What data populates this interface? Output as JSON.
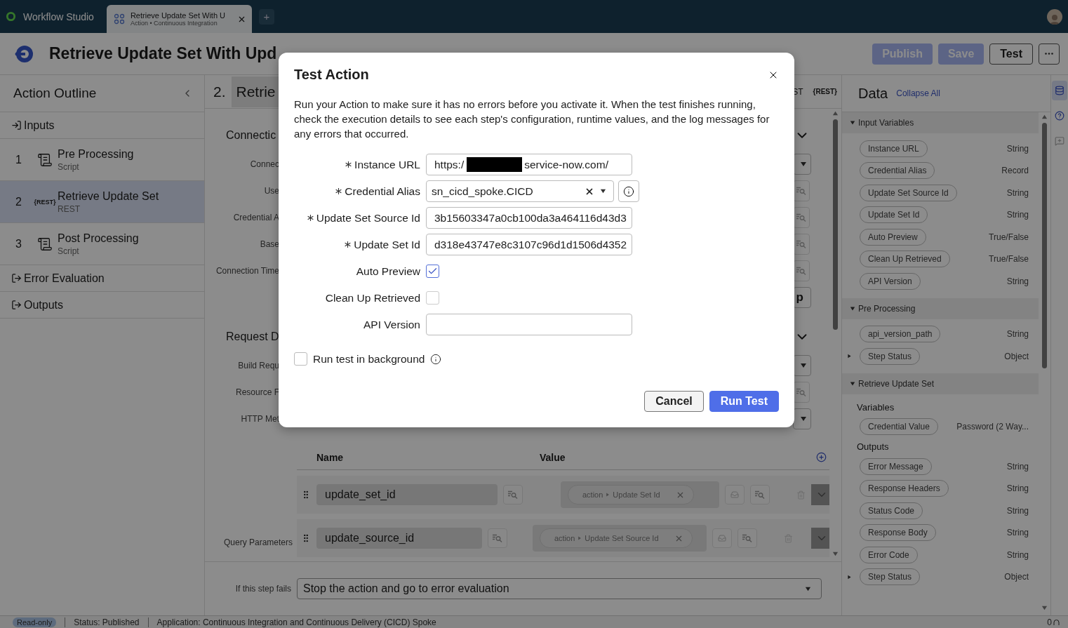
{
  "app": {
    "name": "Workflow Studio"
  },
  "tabs": [
    {
      "title": "Retrieve Update Set With U",
      "subtitle": "Action • Continuous Integration",
      "selected": true
    }
  ],
  "new_tab": "+",
  "header": {
    "title": "Retrieve Update Set With Upd",
    "buttons": [
      {
        "label": "Publish",
        "kind": "primary",
        "disabled": true
      },
      {
        "label": "Save",
        "kind": "primary",
        "disabled": true
      },
      {
        "label": "Test",
        "kind": "secondary",
        "disabled": false
      }
    ]
  },
  "outline": {
    "title": "Action Outline",
    "items": [
      {
        "kind": "entry",
        "label": "Inputs"
      },
      {
        "kind": "script_step",
        "number": "1",
        "name": "Pre Processing",
        "type": "Script",
        "selected": false
      },
      {
        "kind": "rest_step",
        "number": "2",
        "icon_text": "{REST}",
        "name": "Retrieve Update Set",
        "type": "REST",
        "selected": true
      },
      {
        "kind": "script_step",
        "number": "3",
        "name": "Post Processing",
        "type": "Script",
        "selected": false
      },
      {
        "kind": "exit",
        "label": "Error Evaluation"
      },
      {
        "kind": "exit",
        "label": "Outputs"
      }
    ]
  },
  "step": {
    "number": "2.",
    "title": "Retrie",
    "tag": "ST",
    "badge": "{REST}",
    "sections": [
      {
        "title": "Connectic",
        "fields": [
          {
            "kind": "dropdown",
            "label": "Connec"
          },
          {
            "kind": "picker",
            "label": "Use"
          },
          {
            "kind": "picker",
            "label": "Credential A"
          },
          {
            "kind": "picker",
            "label": "Base"
          },
          {
            "kind": "picker",
            "label": "Connection Time"
          },
          {
            "kind": "button",
            "text": "p"
          }
        ]
      },
      {
        "title": "Request D",
        "fields": [
          {
            "kind": "dropdown",
            "label": "Build Requ"
          },
          {
            "kind": "picker",
            "label": "Resource F"
          },
          {
            "kind": "dropdown",
            "label": "HTTP Met"
          }
        ]
      }
    ],
    "table": {
      "label": "Query Parameters",
      "columns": [
        "Name",
        "Value"
      ],
      "rows": [
        {
          "name": "update_set_id",
          "scope": "action",
          "value": "Update Set Id"
        },
        {
          "name": "update_source_id",
          "scope": "action",
          "value": "Update Set Source Id"
        }
      ]
    },
    "on_failure": {
      "label": "If this step fails",
      "value": "Stop the action and go to error evaluation"
    }
  },
  "data": {
    "title": "Data",
    "collapse_link": "Collapse All",
    "groups": [
      {
        "title": "Input Variables",
        "expanded": true,
        "subgroups": [
          {
            "items": [
              {
                "name": "Instance URL",
                "type": "String",
                "expandable": false
              },
              {
                "name": "Credential Alias",
                "type": "Record",
                "expandable": false
              },
              {
                "name": "Update Set Source Id",
                "type": "String",
                "expandable": false
              },
              {
                "name": "Update Set Id",
                "type": "String",
                "expandable": false
              },
              {
                "name": "Auto Preview",
                "type": "True/False",
                "expandable": false
              },
              {
                "name": "Clean Up Retrieved",
                "type": "True/False",
                "expandable": false
              },
              {
                "name": "API Version",
                "type": "String",
                "expandable": false
              }
            ]
          }
        ]
      },
      {
        "title": "Pre Processing",
        "expanded": true,
        "subgroups": [
          {
            "items": [
              {
                "name": "api_version_path",
                "type": "String",
                "expandable": false
              },
              {
                "name": "Step Status",
                "type": "Object",
                "expandable": true
              }
            ]
          }
        ]
      },
      {
        "title": "Retrieve Update Set",
        "expanded": true,
        "subgroups": [
          {
            "title": "Variables",
            "items": [
              {
                "name": "Credential Value",
                "type": "Password (2 Way...",
                "expandable": false
              }
            ]
          },
          {
            "title": "Outputs",
            "items": [
              {
                "name": "Error Message",
                "type": "String",
                "expandable": false
              },
              {
                "name": "Response Headers",
                "type": "String",
                "expandable": false
              },
              {
                "name": "Status Code",
                "type": "String",
                "expandable": false
              },
              {
                "name": "Response Body",
                "type": "String",
                "expandable": false
              },
              {
                "name": "Error Code",
                "type": "String",
                "expandable": false
              },
              {
                "name": "Step Status",
                "type": "Object",
                "expandable": true
              }
            ]
          }
        ]
      }
    ]
  },
  "rail": [
    {
      "kind": "database",
      "selected": true
    },
    {
      "kind": "help",
      "selected": false
    },
    {
      "kind": "chat",
      "selected": false
    }
  ],
  "status_bar": {
    "badge": "Read-only",
    "items": [
      "Status: Published",
      "Application: Continuous Integration and Continuous Delivery (CICD) Spoke"
    ],
    "count": "0"
  },
  "dialog": {
    "title": "Test Action",
    "description": "Run your Action to make sure it has no errors before you activate it. When the test finishes running, check the execution details to see each step's configuration, runtime values, and the log messages for any errors that occurred.",
    "fields": [
      {
        "kind": "text",
        "label": "Instance URL",
        "required": true,
        "value": "https:/",
        "redacted": true,
        "value_after": "service-now.com/"
      },
      {
        "kind": "select",
        "label": "Credential Alias",
        "required": true,
        "value": "sn_cicd_spoke.CICD"
      },
      {
        "kind": "text",
        "label": "Update Set Source Id",
        "required": true,
        "value": "3b15603347a0cb100da3a464116d43d3",
        "redacted": false
      },
      {
        "kind": "text",
        "label": "Update Set Id",
        "required": true,
        "value": "d318e43747e8c3107c96d1d1506d4352",
        "redacted": false
      },
      {
        "kind": "checkbox",
        "label": "Auto Preview",
        "required": false,
        "checked": true
      },
      {
        "kind": "checkbox",
        "label": "Clean Up Retrieved",
        "required": false,
        "checked": false
      },
      {
        "kind": "text",
        "label": "API Version",
        "required": false,
        "redacted": false
      }
    ],
    "background": {
      "label": "Run test in background",
      "checked": false
    },
    "buttons": [
      {
        "label": "Cancel",
        "kind": "secondary"
      },
      {
        "label": "Run Test",
        "kind": "primary"
      }
    ]
  }
}
